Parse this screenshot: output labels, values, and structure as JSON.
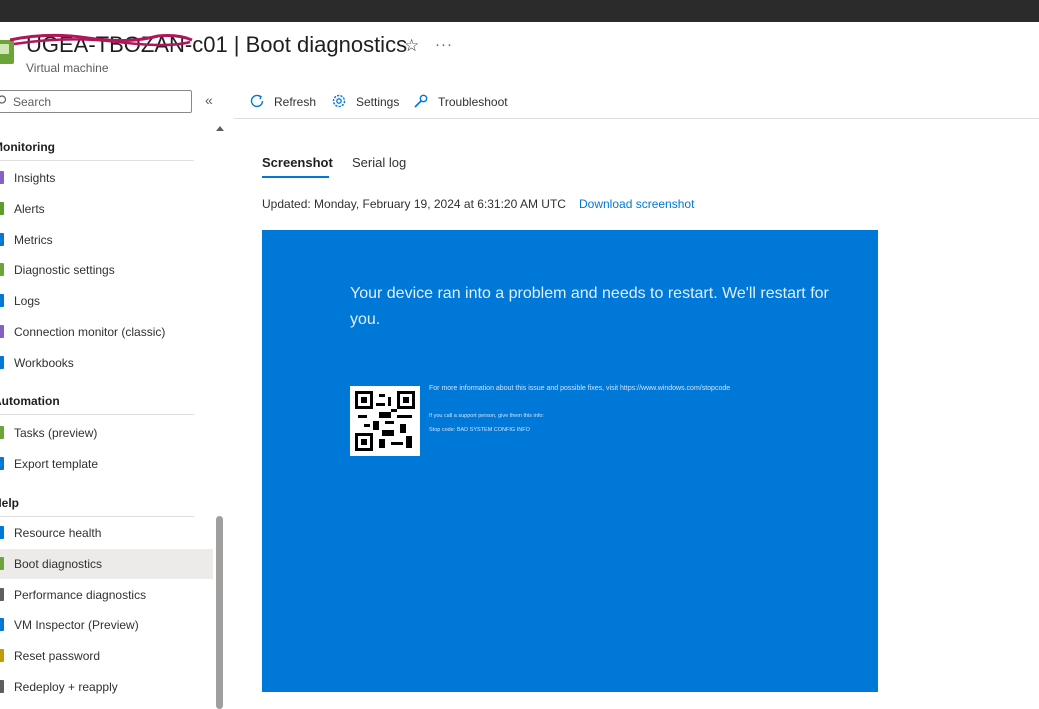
{
  "header": {
    "title": "UGEA-TBOZAN-c01 | Boot diagnostics",
    "subtitle": "Virtual machine"
  },
  "search": {
    "placeholder": "Search"
  },
  "sidebar": {
    "groups": [
      {
        "label": "Monitoring",
        "items": [
          {
            "label": "Insights",
            "icon_color": "#8661c5"
          },
          {
            "label": "Alerts",
            "icon_color": "#5c9d2c"
          },
          {
            "label": "Metrics",
            "icon_color": "#0078d4"
          },
          {
            "label": "Diagnostic settings",
            "icon_color": "#6ba539"
          },
          {
            "label": "Logs",
            "icon_color": "#0078d4"
          },
          {
            "label": "Connection monitor (classic)",
            "icon_color": "#8661c5"
          },
          {
            "label": "Workbooks",
            "icon_color": "#0078d4"
          }
        ]
      },
      {
        "label": "Automation",
        "items": [
          {
            "label": "Tasks (preview)",
            "icon_color": "#6ba539"
          },
          {
            "label": "Export template",
            "icon_color": "#0078d4"
          }
        ]
      },
      {
        "label": "Help",
        "items": [
          {
            "label": "Resource health",
            "icon_color": "#0078d4"
          },
          {
            "label": "Boot diagnostics",
            "icon_color": "#6ba539",
            "active": true
          },
          {
            "label": "Performance diagnostics",
            "icon_color": "#605e5c"
          },
          {
            "label": "VM Inspector (Preview)",
            "icon_color": "#0078d4"
          },
          {
            "label": "Reset password",
            "icon_color": "#c19c00"
          },
          {
            "label": "Redeploy + reapply",
            "icon_color": "#605e5c"
          }
        ]
      }
    ]
  },
  "toolbar": {
    "refresh_label": "Refresh",
    "settings_label": "Settings",
    "troubleshoot_label": "Troubleshoot"
  },
  "tabs": [
    {
      "label": "Screenshot",
      "active": true
    },
    {
      "label": "Serial log",
      "active": false
    }
  ],
  "status": {
    "updated_text": "Updated: Monday, February 19, 2024 at 6:31:20 AM UTC",
    "download_label": "Download screenshot"
  },
  "screenshot": {
    "message": "Your device ran into a problem and needs to restart. We'll restart for you.",
    "info": "For more information about this issue and possible fixes, visit https://www.windows.com/stopcode",
    "support": "If you call a support person, give them this info:",
    "stop_code": "Stop code: BAD SYSTEM CONFIG INFO"
  },
  "colors": {
    "accent": "#0078d4",
    "bsod_background": "#0078d7",
    "active_nav": "#edebe9"
  }
}
